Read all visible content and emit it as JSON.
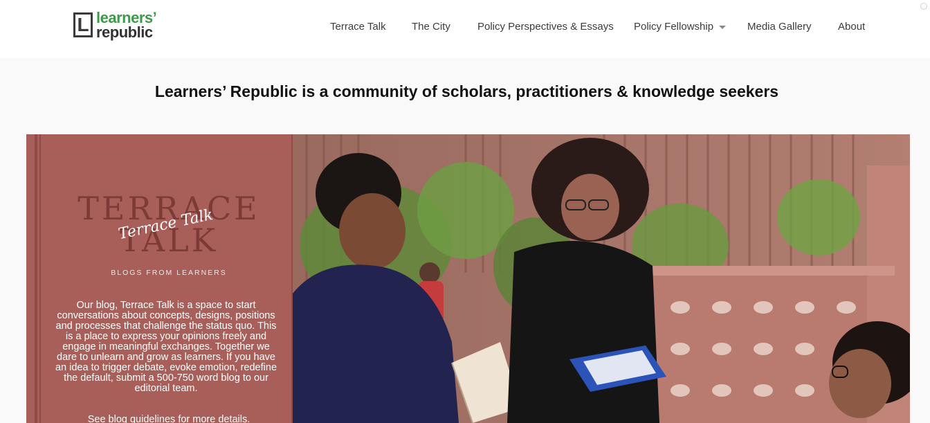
{
  "logo": {
    "letter": "L",
    "line1": "learners’",
    "line2": "republic"
  },
  "nav": {
    "items": [
      {
        "label": "Terrace Talk"
      },
      {
        "label": "The City"
      },
      {
        "label": "Policy Perspectives & Essays"
      },
      {
        "label": "Policy Fellowship"
      },
      {
        "label": "Media Gallery"
      },
      {
        "label": "About"
      }
    ]
  },
  "tagline": "Learners’ Republic is a community of scholars, practitioners & knowledge seekers",
  "hero": {
    "big_title_line1": "TERRACE",
    "big_title_line2": "TALK",
    "script_title": "Terrace Talk",
    "subtitle": "BLOGS FROM LEARNERS",
    "description": "Our blog, Terrace Talk is a space to start conversations about concepts, designs, positions and processes that challenge the status quo. This is a place to express your opinions freely and engage in meaningful exchanges. Together we dare to unlearn and grow as learners. If you have an idea to trigger debate, evoke emotion, redefine the default, submit a 500-750 word blog to our editorial team.",
    "guidelines_link": "See blog guidelines for more details."
  },
  "colors": {
    "brand_green": "#3d9a4b",
    "panel_maroon": "#a85f5a",
    "text_dark": "#111111"
  }
}
